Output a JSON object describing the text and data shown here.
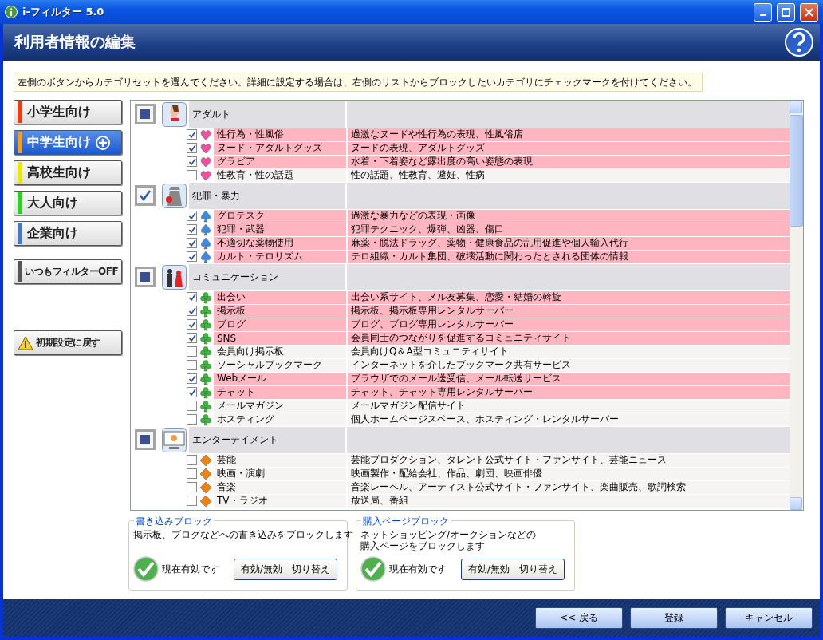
{
  "window": {
    "title": "i-フィルター 5.0"
  },
  "header": {
    "title": "利用者情報の編集"
  },
  "notice": "左側のボタンからカテゴリセットを選んでください。詳細に設定する場合は、右側のリストからブロックしたいカテゴリにチェックマークを付けてください。",
  "presets": [
    {
      "label": "小学生向け",
      "color": "#f03a10",
      "selected": false
    },
    {
      "label": "中学生向け",
      "color": "#f0a020",
      "selected": true
    },
    {
      "label": "高校生向け",
      "color": "#e8e800",
      "selected": false
    },
    {
      "label": "大人向け",
      "color": "#30d020",
      "selected": false
    },
    {
      "label": "企業向け",
      "color": "#4a78c0",
      "selected": false
    }
  ],
  "filter_off": {
    "label": "いつもフィルターOFF",
    "color": "#555555"
  },
  "reset": {
    "label": "初期設定に戻す"
  },
  "groups": [
    {
      "name": "アダルト",
      "checked": false,
      "mixed": true,
      "kind": "adult",
      "items": [
        {
          "name": "性行為・性風俗",
          "description": "過激なヌードや性行為の表現、性風俗店",
          "checked": true
        },
        {
          "name": "ヌード・アダルトグッズ",
          "description": "ヌードの表現、アダルトグッズ",
          "checked": true
        },
        {
          "name": "グラビア",
          "description": "水着・下着姿など露出度の高い姿態の表現",
          "checked": true
        },
        {
          "name": "性教育・性の話題",
          "description": "性の話題、性教育、避妊、性病",
          "checked": false
        }
      ]
    },
    {
      "name": "犯罪・暴力",
      "checked": true,
      "mixed": false,
      "kind": "crime",
      "items": [
        {
          "name": "グロテスク",
          "description": "過激な暴力などの表現・画像",
          "checked": true
        },
        {
          "name": "犯罪・武器",
          "description": "犯罪テクニック、爆弾、凶器、傷口",
          "checked": true
        },
        {
          "name": "不適切な薬物使用",
          "description": "麻薬・脱法ドラッグ、薬物・健康食品の乱用促進や個人輸入代行",
          "checked": true
        },
        {
          "name": "カルト・テロリズム",
          "description": "テロ組織・カルト集団、破壊活動に関わったとされる団体の情報",
          "checked": true
        }
      ]
    },
    {
      "name": "コミュニケーション",
      "checked": false,
      "mixed": true,
      "kind": "people",
      "items": [
        {
          "name": "出会い",
          "description": "出会い系サイト、メル友募集、恋愛・結婚の斡旋",
          "checked": true
        },
        {
          "name": "掲示板",
          "description": "掲示板、掲示板専用レンタルサーバー",
          "checked": true
        },
        {
          "name": "ブログ",
          "description": "ブログ、ブログ専用レンタルサーバー",
          "checked": true
        },
        {
          "name": "SNS",
          "description": "会員同士のつながりを促進するコミュニティサイト",
          "checked": true
        },
        {
          "name": "会員向け掲示板",
          "description": "会員向けQ＆A型コミュニティサイト",
          "checked": false
        },
        {
          "name": "ソーシャルブックマーク",
          "description": "インターネットを介したブックマーク共有サービス",
          "checked": false
        },
        {
          "name": "Webメール",
          "description": "ブラウザでのメール送受信、メール転送サービス",
          "checked": true
        },
        {
          "name": "チャット",
          "description": "チャット、チャット専用レンタルサーバー",
          "checked": true
        },
        {
          "name": "メールマガジン",
          "description": "メールマガジン配信サイト",
          "checked": false
        },
        {
          "name": "ホスティング",
          "description": "個人ホームページスペース、ホスティング・レンタルサーバー",
          "checked": false
        }
      ]
    },
    {
      "name": "エンターテイメント",
      "checked": false,
      "mixed": true,
      "kind": "monitor",
      "items": [
        {
          "name": "芸能",
          "description": "芸能プロダクション、タレント公式サイト・ファンサイト、芸能ニュース",
          "checked": false
        },
        {
          "name": "映画・演劇",
          "description": "映画製作・配給会社、作品、劇団、映画俳優",
          "checked": false
        },
        {
          "name": "音楽",
          "description": "音楽レーベル、アーティスト公式サイト・ファンサイト、楽曲販売、歌詞検索",
          "checked": false
        },
        {
          "name": "TV・ラジオ",
          "description": "放送局、番組",
          "checked": false
        }
      ]
    }
  ],
  "blocks": [
    {
      "title": "書き込みブロック",
      "description": [
        "掲示板、ブログなどへの書き込みをブロックします"
      ],
      "status": "現在有効です",
      "enabled": true,
      "button": "有効/無効　切り替え"
    },
    {
      "title": "購入ページブロック",
      "description": [
        "ネットショッピング/オークションなどの",
        "購入ページをブロックします"
      ],
      "status": "現在有効です",
      "enabled": true,
      "button": "有効/無効　切り替え"
    }
  ],
  "footer_buttons": [
    "<< 戻る",
    "登録",
    "キャンセル"
  ]
}
